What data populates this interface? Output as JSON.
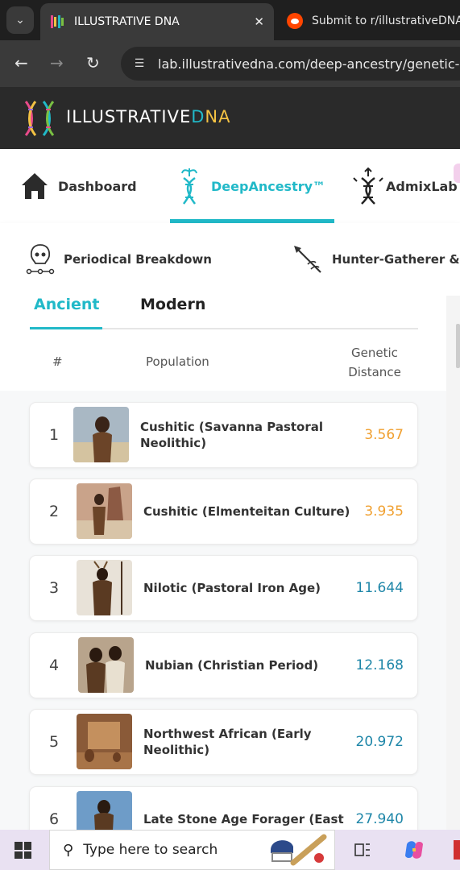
{
  "browser": {
    "tabs": [
      {
        "title": "ILLUSTRATIVE DNA",
        "close": "✕"
      },
      {
        "title": "Submit to r/illustrativeDNA"
      }
    ],
    "url": "lab.illustrativedna.com/deep-ancestry/genetic-di"
  },
  "site": {
    "brand_main": "ILLUSTRATIVE",
    "brand_d": "D",
    "brand_na": "NA"
  },
  "main_nav": [
    {
      "label": "Dashboard",
      "icon": "house-icon"
    },
    {
      "label": "DeepAncestry™",
      "icon": "dna-leaf-icon",
      "active": true
    },
    {
      "label": "AdmixLab",
      "icon": "dna-network-icon"
    }
  ],
  "sub_nav": [
    {
      "label": "Periodical Breakdown",
      "icon": "skull-timeline-icon"
    },
    {
      "label": "Hunter-Gatherer &",
      "icon": "spear-icon"
    }
  ],
  "tabs": {
    "ancient": "Ancient",
    "modern": "Modern"
  },
  "table": {
    "headers": {
      "rank": "#",
      "population": "Population",
      "distance_line1": "Genetic",
      "distance_line2": "Distance"
    },
    "rows": [
      {
        "rank": "1",
        "name": "Cushitic (Savanna Pastoral Neolithic)",
        "distance": "3.567",
        "tone": "orange"
      },
      {
        "rank": "2",
        "name": "Cushitic (Elmenteitan Culture)",
        "distance": "3.935",
        "tone": "orange"
      },
      {
        "rank": "3",
        "name": "Nilotic (Pastoral Iron Age)",
        "distance": "11.644",
        "tone": "teal"
      },
      {
        "rank": "4",
        "name": "Nubian (Christian Period)",
        "distance": "12.168",
        "tone": "teal"
      },
      {
        "rank": "5",
        "name": "Northwest African (Early Neolithic)",
        "distance": "20.972",
        "tone": "teal"
      },
      {
        "rank": "6",
        "name": "Late Stone Age Forager (East",
        "distance": "27.940",
        "tone": "teal"
      }
    ]
  },
  "taskbar": {
    "search_placeholder": "Type here to search"
  },
  "colors": {
    "accent": "#21b9c8",
    "orange": "#f0a030",
    "teal": "#1e86a8"
  }
}
